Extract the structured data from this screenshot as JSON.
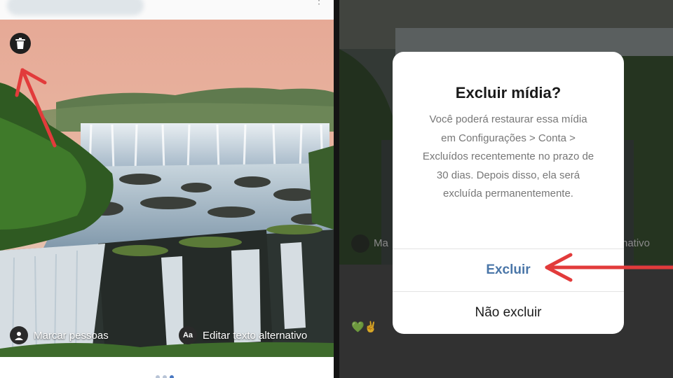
{
  "left": {
    "photo_actions": {
      "tag_people": "Marcar pessoas",
      "edit_alt_text": "Editar texto alternativo",
      "alt_icon_text": "Aa"
    }
  },
  "right": {
    "background": {
      "tag_text_partial": "Ma",
      "alt_text_partial": "rnativo",
      "emoji": "💚✌"
    },
    "dialog": {
      "title": "Excluir mídia?",
      "body": "Você poderá restaurar essa mídia em Configurações > Conta > Excluídos recentemente no prazo de 30 dias. Depois disso, ela será excluída permanentemente.",
      "delete_label": "Excluir",
      "cancel_label": "Não excluir"
    }
  },
  "colors": {
    "delete_accent": "#4a76a8",
    "annotation_arrow": "#e23b3b"
  },
  "icons": [
    "trash-icon",
    "person-icon",
    "text-icon",
    "arrow-annotation"
  ]
}
